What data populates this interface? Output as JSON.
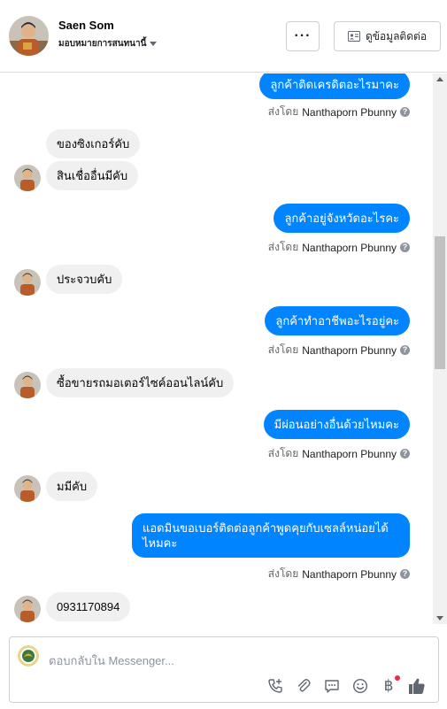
{
  "header": {
    "name": "Saen Som",
    "assigned": "มอบหมายการสนทนานี้",
    "more_label": "···",
    "contact_label": "ดูข้อมูลติดต่อ"
  },
  "sent_by": {
    "prefix": "ส่งโดย",
    "author": "Nanthaporn Pbunny"
  },
  "messages": [
    {
      "dir": "out",
      "text": "ลูกค้าติดเครดิตอะไรมาคะ"
    },
    {
      "dir": "in",
      "text": "ของซิงเกอร์คับ"
    },
    {
      "dir": "in",
      "text": "สินเชื่ออื่นมีคับ"
    },
    {
      "dir": "out",
      "text": "ลูกค้าอยู่จังหวัดอะไรคะ"
    },
    {
      "dir": "in",
      "text": "ประจวบคับ"
    },
    {
      "dir": "out",
      "text": "ลูกค้าทำอาชีพอะไรอยู่คะ"
    },
    {
      "dir": "in",
      "text": "ซื้อขายรถมอเตอร์ไซค์ออนไลน์คับ"
    },
    {
      "dir": "out",
      "text": "มีผ่อนอย่างอื่นด้วยไหมคะ"
    },
    {
      "dir": "in",
      "text": "มมีคับ"
    },
    {
      "dir": "out",
      "text": "แอดมินขอเบอร์ติดต่อลูกค้าพูดคุยกับเซลล์หน่อยได้ไหมคะ"
    },
    {
      "dir": "in",
      "text": "0931170894"
    }
  ],
  "composer": {
    "placeholder": "ตอบกลับใน Messenger..."
  },
  "icons": [
    "more-icon",
    "contact-card-icon",
    "call-add-icon",
    "attach-icon",
    "saved-reply-icon",
    "emoji-icon",
    "baht-icon",
    "like-icon"
  ],
  "colors": {
    "outgoing": "#0084ff",
    "incoming": "#f0f0f0",
    "like": "#606770",
    "badge": "#f02849"
  }
}
